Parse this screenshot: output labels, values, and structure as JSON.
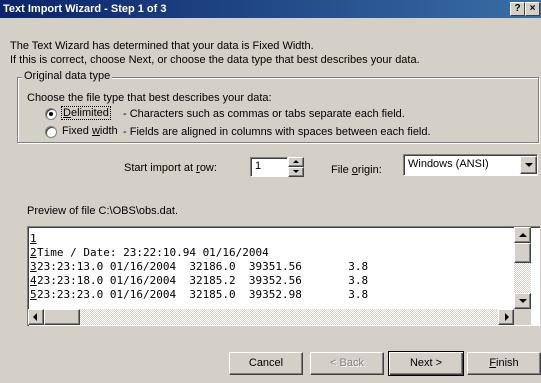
{
  "window": {
    "title": "Text Import Wizard - Step 1 of 3",
    "help_label": "?",
    "close_label": "×"
  },
  "intro": {
    "line1": "The Text Wizard has determined that your data is Fixed Width.",
    "line2": "If this is correct, choose Next, or choose the data type that best describes your data."
  },
  "original_data_type": {
    "legend": "Original data type",
    "prompt": "Choose the file type that best describes your data:",
    "options": [
      {
        "label_pre": "",
        "label_accel": "D",
        "label_post": "elimited",
        "description": "- Characters such as commas or tabs separate each field.",
        "checked": true
      },
      {
        "label_pre": "Fixed ",
        "label_accel": "w",
        "label_post": "idth",
        "description": "- Fields are aligned in columns with spaces between each field.",
        "checked": false
      }
    ]
  },
  "start_row": {
    "label_pre": "Start import at ",
    "label_accel": "r",
    "label_post": "ow:",
    "value": "1"
  },
  "file_origin": {
    "label_pre": "File ",
    "label_accel": "o",
    "label_post": "rigin:",
    "value": "Windows (ANSI)"
  },
  "preview": {
    "label": "Preview of file C:\\OBS\\obs.dat.",
    "rows": [
      {
        "num": "1",
        "text": ""
      },
      {
        "num": "2",
        "text": "Time / Date: 23:22:10.94 01/16/2004"
      },
      {
        "num": "3",
        "text": "23:23:13.0 01/16/2004  32186.0  39351.56       3.8"
      },
      {
        "num": "4",
        "text": "23:23:18.0 01/16/2004  32185.2  39352.56       3.8"
      },
      {
        "num": "5",
        "text": "23:23:23.0 01/16/2004  32185.0  39352.98       3.8"
      }
    ]
  },
  "buttons": {
    "cancel": "Cancel",
    "back": "< Back",
    "next": "Next >",
    "finish_accel": "F",
    "finish_rest": "inish"
  }
}
